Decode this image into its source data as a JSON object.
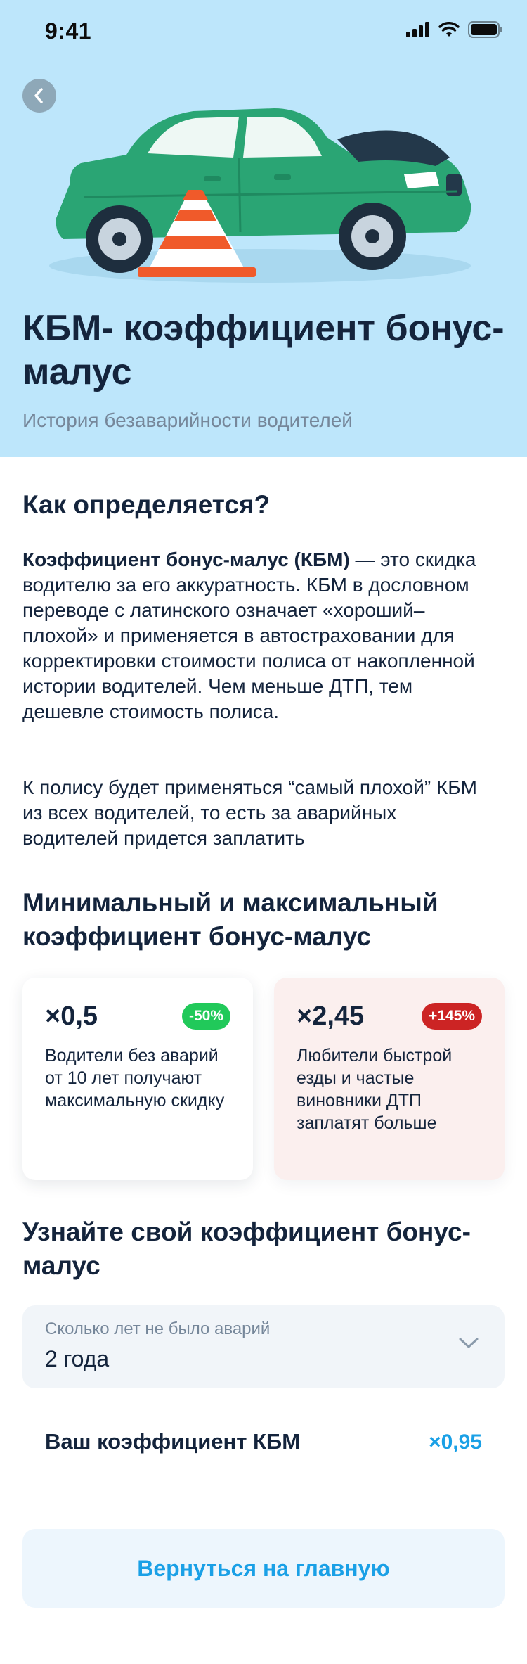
{
  "status_bar": {
    "time": "9:41"
  },
  "hero": {
    "title": "КБМ- коэффициент бонус-малус",
    "subtitle": "История безаварийности водителей"
  },
  "how_section": {
    "title": "Как определяется?",
    "paragraph1_bold": "Коэффициент бонус-малус (КБМ)",
    "paragraph1_rest": " — это скидка водителю за его аккуратность. КБМ в дословном переводе с латинского означает «хороший–плохой» и применяется в автостраховании для корректировки стоимости полиса от накопленной истории водителей. Чем меньше ДТП, тем дешевле стоимость полиса.",
    "paragraph2": "К полису будет применяться “самый плохой” КБМ из всех водителей, то есть за аварийных водителей придется заплатить"
  },
  "range_section": {
    "title": "Минимальный и максимальный коэффициент бонус-малус",
    "min_card": {
      "value": "×0,5",
      "badge": "-50%",
      "description": "Водители без аварий от 10 лет получают максимальную скидку"
    },
    "max_card": {
      "value": "×2,45",
      "badge": "+145%",
      "description": "Любители быстрой езды и частые виновники ДТП заплатят больше"
    }
  },
  "calculator": {
    "title": "Узнайте свой коэффициент бонус-малус",
    "select_label": "Сколько лет не было аварий",
    "select_value": "2 года",
    "result_label": "Ваш коэффициент КБМ",
    "result_value": "×0,95"
  },
  "home_button_label": "Вернуться на главную",
  "colors": {
    "hero_bg": "#bde6fb",
    "accent": "#1aa0e6",
    "text": "#14243c",
    "muted": "#76879a",
    "badge_green": "#21c95a",
    "badge_red": "#cc2424",
    "car": "#2aa574"
  },
  "icons": [
    "signal-icon",
    "wifi-icon",
    "battery-icon",
    "back-arrow-icon",
    "chevron-down-icon"
  ]
}
